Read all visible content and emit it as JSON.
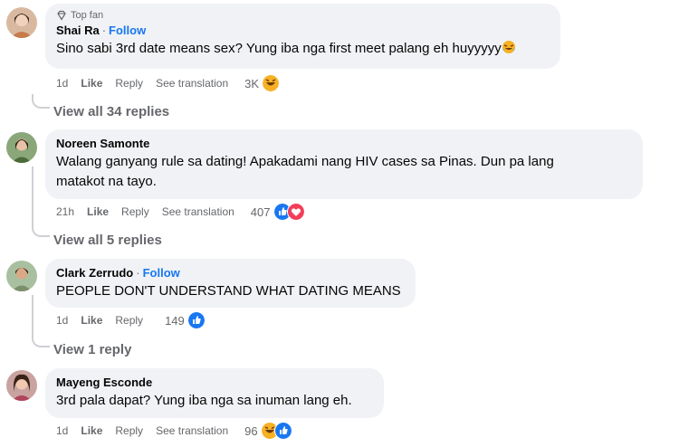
{
  "comments": [
    {
      "badge": "Top fan",
      "name": "Shai Ra",
      "follow": "Follow",
      "text": "Sino sabi 3rd date means sex? Yung iba nga first meet palang eh huyyyyy",
      "time": "1d",
      "like": "Like",
      "reply": "Reply",
      "translate": "See translation",
      "reactions": "3K",
      "reaction_icons": [
        "haha-icon"
      ],
      "view_replies": "View all 34 replies"
    },
    {
      "name": "Noreen Samonte",
      "text_lines": [
        "Walang ganyang rule sa dating! Apakadami nang HIV cases sa Pinas. Dun pa lang",
        "matakot na tayo."
      ],
      "time": "21h",
      "like": "Like",
      "reply": "Reply",
      "translate": "See translation",
      "reactions": "407",
      "reaction_icons": [
        "like-icon",
        "love-icon"
      ],
      "view_replies": "View all 5 replies"
    },
    {
      "name": "Clark Zerrudo",
      "follow": "Follow",
      "text": "PEOPLE DON'T UNDERSTAND WHAT DATING MEANS",
      "time": "1d",
      "like": "Like",
      "reply": "Reply",
      "reactions": "149",
      "reaction_icons": [
        "like-icon"
      ],
      "view_replies": "View 1 reply"
    },
    {
      "name": "Mayeng Esconde",
      "text": "3rd pala dapat? Yung iba nga sa inuman lang eh.",
      "time": "1d",
      "like": "Like",
      "reply": "Reply",
      "translate": "See translation",
      "reactions": "96",
      "reaction_icons": [
        "haha-icon",
        "like-icon"
      ]
    }
  ],
  "colors": {
    "bubble": "#f0f2f5",
    "link": "#1877f2",
    "meta": "#65676b",
    "like": "#1877f2",
    "love": "#f33e58",
    "haha": "#f7b125"
  }
}
